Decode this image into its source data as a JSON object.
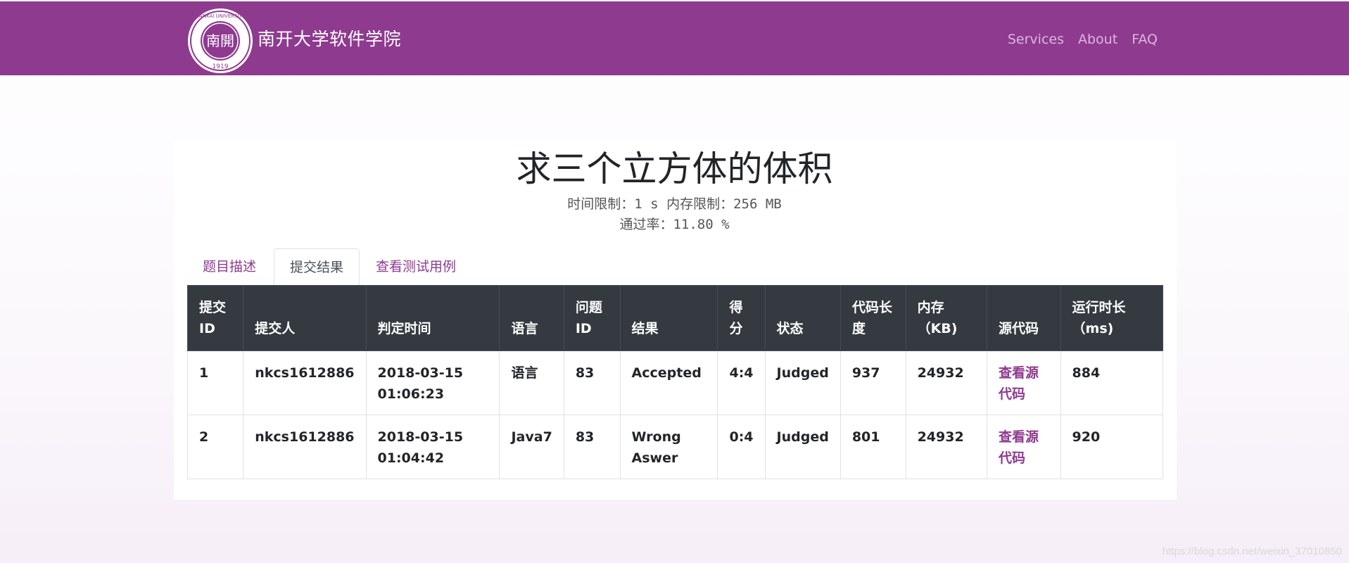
{
  "header": {
    "brand": "南开大学软件学院",
    "logo_name": "nankai-university-seal",
    "logo_text_top": "NANKAI UNIVERSITY",
    "logo_text_center": "南開",
    "logo_text_year": "1919",
    "nav": [
      "Services",
      "About",
      "FAQ"
    ],
    "brand_color": "#8e3a8f"
  },
  "problem": {
    "title": "求三个立方体的体积",
    "time_limit_label": "时间限制：",
    "time_limit_value": "1 s",
    "memory_limit_label": "内存限制：",
    "memory_limit_value": "256 MB",
    "pass_rate_label": "通过率：",
    "pass_rate_value": "11.80 %"
  },
  "tabs": {
    "description": "题目描述",
    "results": "提交结果",
    "testcases": "查看测试用例",
    "active": "提交结果"
  },
  "table": {
    "headers": [
      "提交ID",
      "提交人",
      "判定时间",
      "语言",
      "问题ID",
      "结果",
      "得分",
      "状态",
      "代码长度",
      "内存（KB)",
      "源代码",
      "运行时长（ms)"
    ],
    "rows": [
      [
        "1",
        "nkcs1612886",
        "2018-03-15 01:06:23",
        "语言",
        "83",
        "Accepted",
        "4:4",
        "Judged",
        "937",
        "24932",
        "查看源代码",
        "884"
      ],
      [
        "2",
        "nkcs1612886",
        "2018-03-15 01:04:42",
        "Java7",
        "83",
        "Wrong Aswer",
        "0:4",
        "Judged",
        "801",
        "24932",
        "查看源代码",
        "920"
      ]
    ]
  },
  "watermark": "https://blog.csdn.net/weixin_37010850"
}
